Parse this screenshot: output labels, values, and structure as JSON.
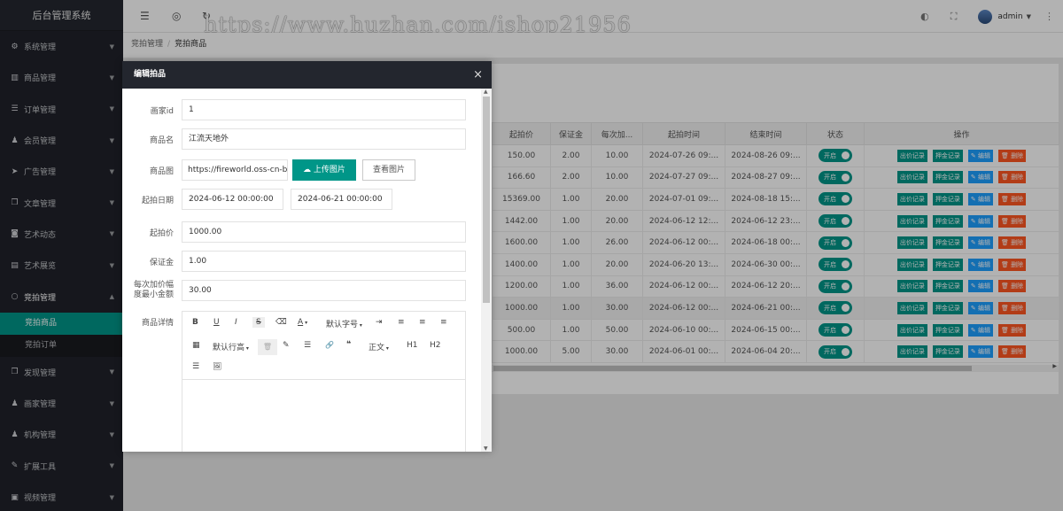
{
  "sidebar": {
    "title": "后台管理系统",
    "menu": [
      {
        "icon": "gear-icon",
        "glyph": "⚙",
        "label": "系统管理"
      },
      {
        "icon": "chart-icon",
        "glyph": "▥",
        "label": "商品管理"
      },
      {
        "icon": "list-icon",
        "glyph": "☰",
        "label": "订单管理"
      },
      {
        "icon": "users-icon",
        "glyph": "♟",
        "label": "会员管理"
      },
      {
        "icon": "send-icon",
        "glyph": "➤",
        "label": "广告管理"
      },
      {
        "icon": "copy-icon",
        "glyph": "❐",
        "label": "文章管理"
      },
      {
        "icon": "camera-icon",
        "glyph": "◙",
        "label": "艺术动态"
      },
      {
        "icon": "book-icon",
        "glyph": "▤",
        "label": "艺术展览"
      },
      {
        "icon": "circle-icon",
        "glyph": "○",
        "label": "竞拍管理"
      },
      {
        "icon": "copy-icon",
        "glyph": "❐",
        "label": "发现管理"
      },
      {
        "icon": "user-icon",
        "glyph": "♟",
        "label": "画家管理"
      },
      {
        "icon": "user-icon",
        "glyph": "♟",
        "label": "机构管理"
      },
      {
        "icon": "wrench-icon",
        "glyph": "✎",
        "label": "扩展工具"
      },
      {
        "icon": "video-icon",
        "glyph": "▣",
        "label": "视频管理"
      }
    ],
    "auction_sub": [
      "竞拍商品",
      "竞拍订单"
    ]
  },
  "topbar": {
    "watermark": "https://www.huzhan.com/ishop21956",
    "user": "admin"
  },
  "breadcrumb": {
    "parent": "竞拍管理",
    "separator": "/",
    "current": "竞拍商品"
  },
  "table": {
    "headers": [
      "起拍价",
      "保证金",
      "每次加...",
      "起拍时间",
      "结束时间",
      "状态",
      "操作"
    ],
    "rows": [
      [
        "150.00",
        "2.00",
        "10.00",
        "2024-07-26 09:...",
        "2024-08-26 09:..."
      ],
      [
        "166.60",
        "2.00",
        "10.00",
        "2024-07-27 09:...",
        "2024-08-27 09:..."
      ],
      [
        "15369.00",
        "1.00",
        "20.00",
        "2024-07-01 09:...",
        "2024-08-18 15:..."
      ],
      [
        "1442.00",
        "1.00",
        "20.00",
        "2024-06-12 12:...",
        "2024-06-12 23:..."
      ],
      [
        "1600.00",
        "1.00",
        "26.00",
        "2024-06-12 00:...",
        "2024-06-18 00:..."
      ],
      [
        "1400.00",
        "1.00",
        "20.00",
        "2024-06-20 13:...",
        "2024-06-30 00:..."
      ],
      [
        "1200.00",
        "1.00",
        "36.00",
        "2024-06-12 00:...",
        "2024-06-12 20:..."
      ],
      [
        "1000.00",
        "1.00",
        "30.00",
        "2024-06-12 00:...",
        "2024-06-21 00:..."
      ],
      [
        "500.00",
        "1.00",
        "50.00",
        "2024-06-10 00:...",
        "2024-06-15 00:..."
      ],
      [
        "1000.00",
        "5.00",
        "30.00",
        "2024-06-01 00:...",
        "2024-06-04 20:..."
      ]
    ],
    "status_label": "开启",
    "actions": [
      "出价记录",
      "押金记录",
      "编辑",
      "删除"
    ]
  },
  "modal": {
    "title": "编辑拍品",
    "close": "×",
    "fields": {
      "painter_id_label": "画家id",
      "painter_id": "1",
      "name_label": "商品名",
      "name": "江流天地外",
      "image_label": "商品图",
      "image": "https://fireworld.oss-cn-beijin",
      "upload_label": "上传图片",
      "view_label": "查看图片",
      "date_label": "起拍日期",
      "date_start": "2024-06-12 00:00:00",
      "date_end": "2024-06-21 00:00:00",
      "start_price_label": "起拍价",
      "start_price": "1000.00",
      "deposit_label": "保证金",
      "deposit": "1.00",
      "increment_label_1": "每次加价幅",
      "increment_label_2": "度最小金额",
      "increment": "30.00",
      "detail_label": "商品详情"
    },
    "editor_toolbar": {
      "bold": "B",
      "underline": "U",
      "italic": "I",
      "strike": "S",
      "eraser": "⌫",
      "font_color": "A",
      "font_size": "默认字号",
      "indent": "⇥",
      "align_left": "≡",
      "align_center": "≡",
      "align_right": "≡",
      "table": "▦",
      "line_height": "默认行高",
      "delete": "🗑",
      "brush": "✎",
      "hr": "☰",
      "link": "🔗",
      "quote": "❝",
      "paragraph": "正文",
      "h1": "H1",
      "h2": "H2",
      "list": "☰",
      "image": "🖼"
    }
  }
}
